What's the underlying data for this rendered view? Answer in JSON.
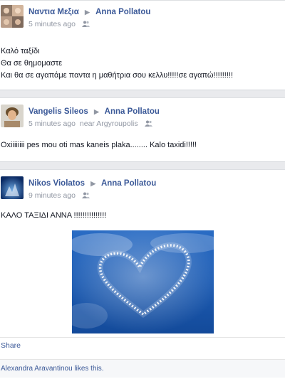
{
  "posts": [
    {
      "author": "Ναντια Μεξια",
      "target": "Anna Pollatou",
      "time": "5 minutes ago",
      "location": "",
      "lines": [
        "Καλό ταξίδι",
        "Θα σε θημομαστε",
        "Και θα σε αγαπάμε παντα η μαθήτρια σου κελλυ!!!!!σε αγαπώ!!!!!!!!!"
      ]
    },
    {
      "author": "Vangelis Sileos",
      "target": "Anna Pollatou",
      "time": "5 minutes ago",
      "location": "near Argyroupolis",
      "lines": [
        "Oxiiiiiiii pes mou oti mas kaneis plaka........ Kalo taxidi!!!!!"
      ]
    },
    {
      "author": "Nikos Violatos",
      "target": "Anna Pollatou",
      "time": "9 minutes ago",
      "location": "",
      "lines": [
        "ΚΑΛΟ ΤΑΞΙΔΙ ΑΝΝΑ !!!!!!!!!!!!!!!"
      ],
      "share_label": "Share",
      "likes_text": "Alexandra Aravantinou likes this."
    }
  ],
  "icons": {
    "arrow": "triangle-right-icon",
    "audience": "friends-audience-icon"
  },
  "colors": {
    "link": "#3b5998",
    "meta": "#9197a3",
    "sky": "#1e5fb8"
  }
}
